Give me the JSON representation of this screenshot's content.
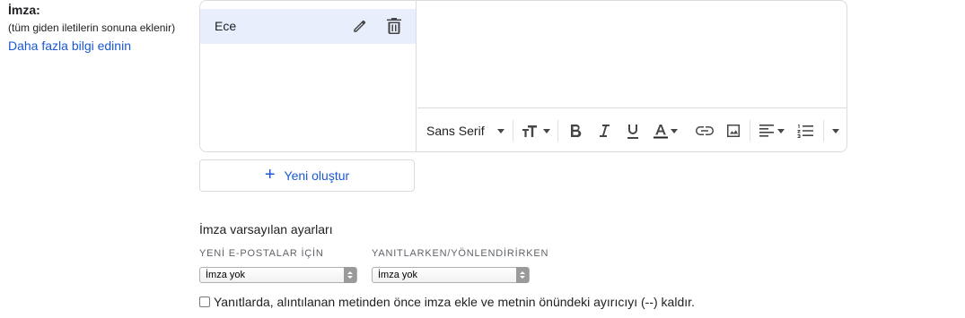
{
  "signature_section": {
    "title": "İmza:",
    "subtitle": "(tüm giden iletilerin sonuna eklenir)",
    "learn_more_link": "Daha fazla bilgi edinin"
  },
  "signature_list": {
    "items": [
      {
        "name": "Ece",
        "selected": true
      }
    ]
  },
  "editor_toolbar": {
    "font_family": "Sans Serif",
    "buttons": [
      "text-size-icon",
      "bold-icon",
      "italic-icon",
      "underline-icon",
      "text-color-icon",
      "link-icon",
      "image-icon",
      "align-icon",
      "numbered-list-icon",
      "more-options-icon"
    ]
  },
  "new_signature_button": {
    "label": "Yeni oluştur"
  },
  "defaults": {
    "title": "İmza varsayılan ayarları",
    "new_emails_label": "YENİ E-POSTALAR İÇİN",
    "new_emails_value": "İmza yok",
    "reply_forward_label": "YANITLARKEN/YÖNLENDİRİRKEN",
    "reply_forward_value": "İmza yok"
  },
  "reply_option": {
    "label": "Yanıtlarda, alıntılanan metinden önce imza ekle ve metnin önündeki ayırıcıyı (--) kaldır.",
    "checked": false
  },
  "colors": {
    "accent": "#1a57d6",
    "selected_row": "#e8eefb",
    "border": "#dadce0"
  }
}
